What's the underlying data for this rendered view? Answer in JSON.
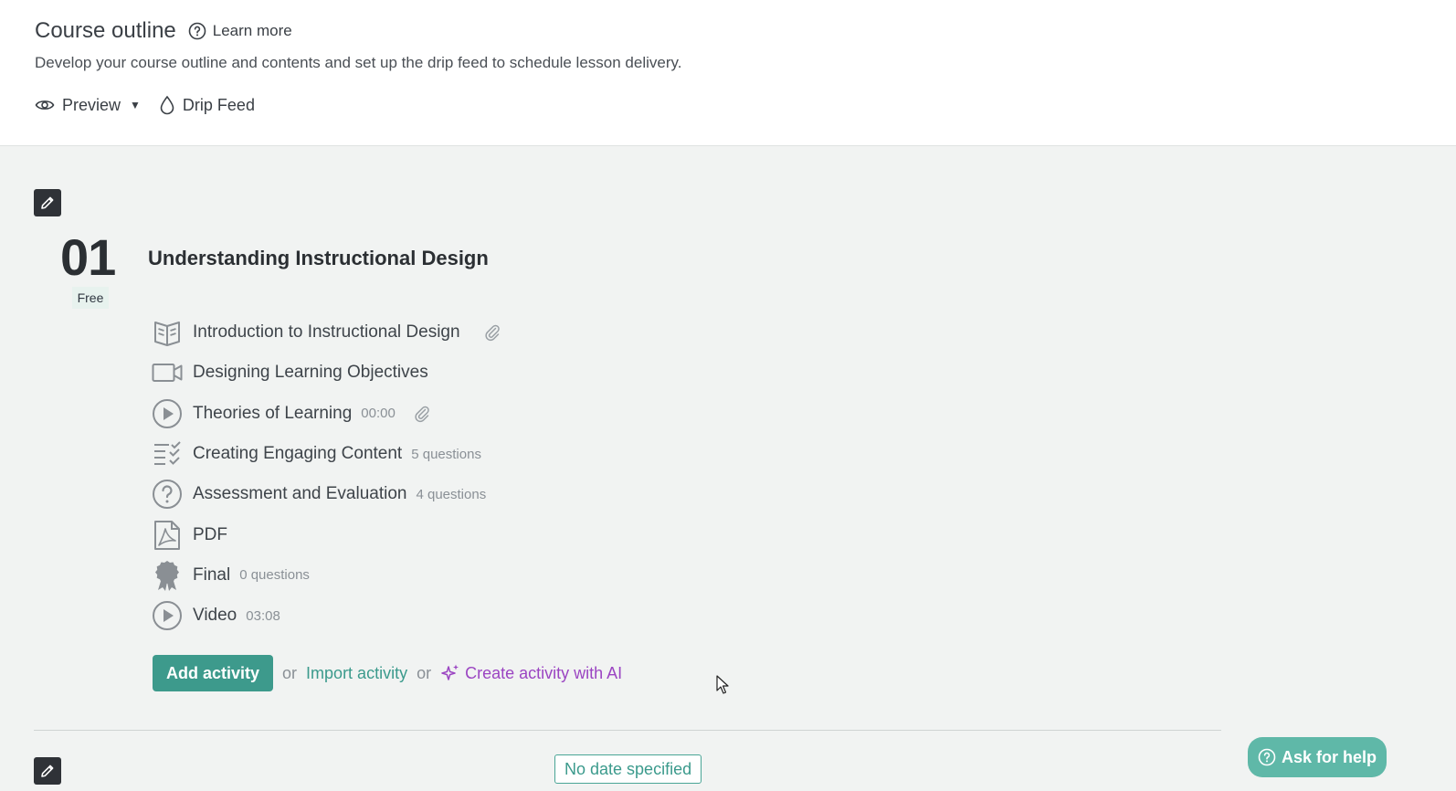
{
  "header": {
    "title": "Course outline",
    "learn_more": "Learn more",
    "subtitle": "Develop your course outline and contents and set up the drip feed to schedule lesson delivery.",
    "preview_label": "Preview",
    "drip_feed_label": "Drip Feed"
  },
  "section": {
    "number": "01",
    "badge": "Free",
    "title": "Understanding Instructional Design",
    "activities": [
      {
        "name": "Introduction to Instructional Design",
        "meta": "",
        "icon": "book-icon",
        "attachment": true
      },
      {
        "name": "Designing Learning Objectives",
        "meta": "",
        "icon": "video-camera-icon",
        "attachment": false
      },
      {
        "name": "Theories of Learning",
        "meta": "00:00",
        "icon": "play-circle-icon",
        "attachment": true
      },
      {
        "name": "Creating Engaging Content",
        "meta": "5 questions",
        "icon": "checklist-icon",
        "attachment": false
      },
      {
        "name": "Assessment and Evaluation",
        "meta": "4 questions",
        "icon": "question-circle-icon",
        "attachment": false
      },
      {
        "name": "PDF",
        "meta": "",
        "icon": "pdf-icon",
        "attachment": false
      },
      {
        "name": "Final",
        "meta": "0 questions",
        "icon": "award-icon",
        "attachment": false
      },
      {
        "name": "Video",
        "meta": "03:08",
        "icon": "play-circle-icon",
        "attachment": false
      }
    ]
  },
  "actions": {
    "add_activity": "Add activity",
    "or_1": "or",
    "import_activity": "Import activity",
    "or_2": "or",
    "create_ai": "Create activity with AI"
  },
  "next_section": {
    "date_label": "No date specified"
  },
  "help": {
    "label": "Ask for help"
  },
  "colors": {
    "accent": "#3d9a8c",
    "ai": "#9b45c2",
    "help": "#5fb8a8"
  }
}
